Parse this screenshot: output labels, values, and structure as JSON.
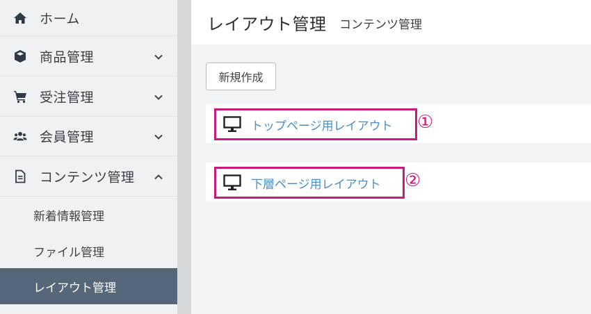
{
  "sidebar": {
    "items": [
      {
        "label": "ホーム",
        "icon": "home-icon"
      },
      {
        "label": "商品管理",
        "icon": "cube-icon",
        "chevron": "down"
      },
      {
        "label": "受注管理",
        "icon": "cart-icon",
        "chevron": "down"
      },
      {
        "label": "会員管理",
        "icon": "users-icon",
        "chevron": "down"
      },
      {
        "label": "コンテンツ管理",
        "icon": "file-icon",
        "chevron": "up"
      }
    ],
    "sub_items": [
      {
        "label": "新着情報管理",
        "active": false
      },
      {
        "label": "ファイル管理",
        "active": false
      },
      {
        "label": "レイアウト管理",
        "active": true
      }
    ]
  },
  "header": {
    "title": "レイアウト管理",
    "subtitle": "コンテンツ管理"
  },
  "main": {
    "new_button_label": "新規作成",
    "layouts": [
      {
        "label": "トップページ用レイアウト",
        "marker": "①",
        "icon": "desktop-icon"
      },
      {
        "label": "下層ページ用レイアウト",
        "marker": "②",
        "icon": "desktop-icon"
      }
    ]
  },
  "colors": {
    "sidebar_active_bg": "#56677a",
    "highlight_border": "#c8197d",
    "link_text": "#4c8ec4"
  }
}
